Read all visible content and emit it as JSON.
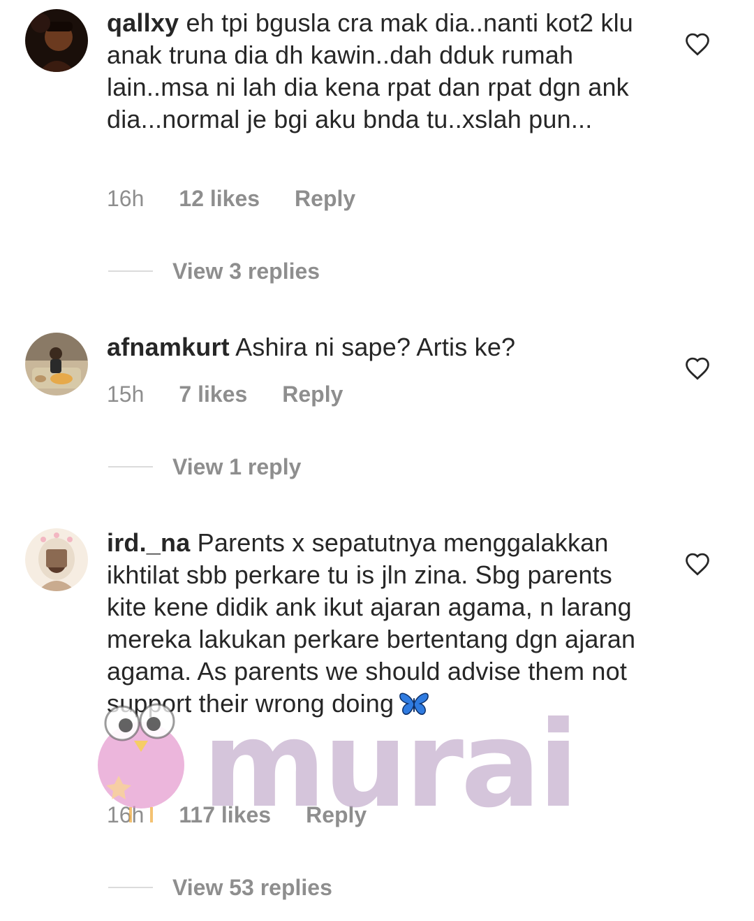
{
  "comments": [
    {
      "username": "qallxy",
      "text": "eh tpi bgusla cra mak dia..nanti kot2 klu anak truna dia dh kawin..dah dduk rumah lain..msa ni lah dia kena rpat dan rpat dgn ank dia...normal je bgi aku bnda tu..xslah pun...",
      "time": "16h",
      "likes": "12 likes",
      "reply_label": "Reply",
      "view_replies": "View 3 replies"
    },
    {
      "username": "afnamkurt",
      "text": "Ashira ni sape? Artis ke?",
      "time": "15h",
      "likes": "7 likes",
      "reply_label": "Reply",
      "view_replies": "View 1 reply"
    },
    {
      "username": "ird._na",
      "text": "Parents x sepatutnya menggalakkan ikhtilat sbb perkare tu is jln zina. Sbg parents kite kene didik ank ikut ajaran agama, n larang mereka lakukan perkare bertentang dgn ajaran agama. As parents we should advise them not support their wrong doing",
      "emoji": "butterfly",
      "time": "16h",
      "likes": "117 likes",
      "reply_label": "Reply",
      "view_replies": "View 53 replies"
    }
  ],
  "watermark": {
    "text": "murai",
    "color": "#b296be"
  },
  "colors": {
    "text": "#262626",
    "muted": "#8e8e8e",
    "divider": "#dbdbdb",
    "butterfly": "#3b82f6"
  }
}
